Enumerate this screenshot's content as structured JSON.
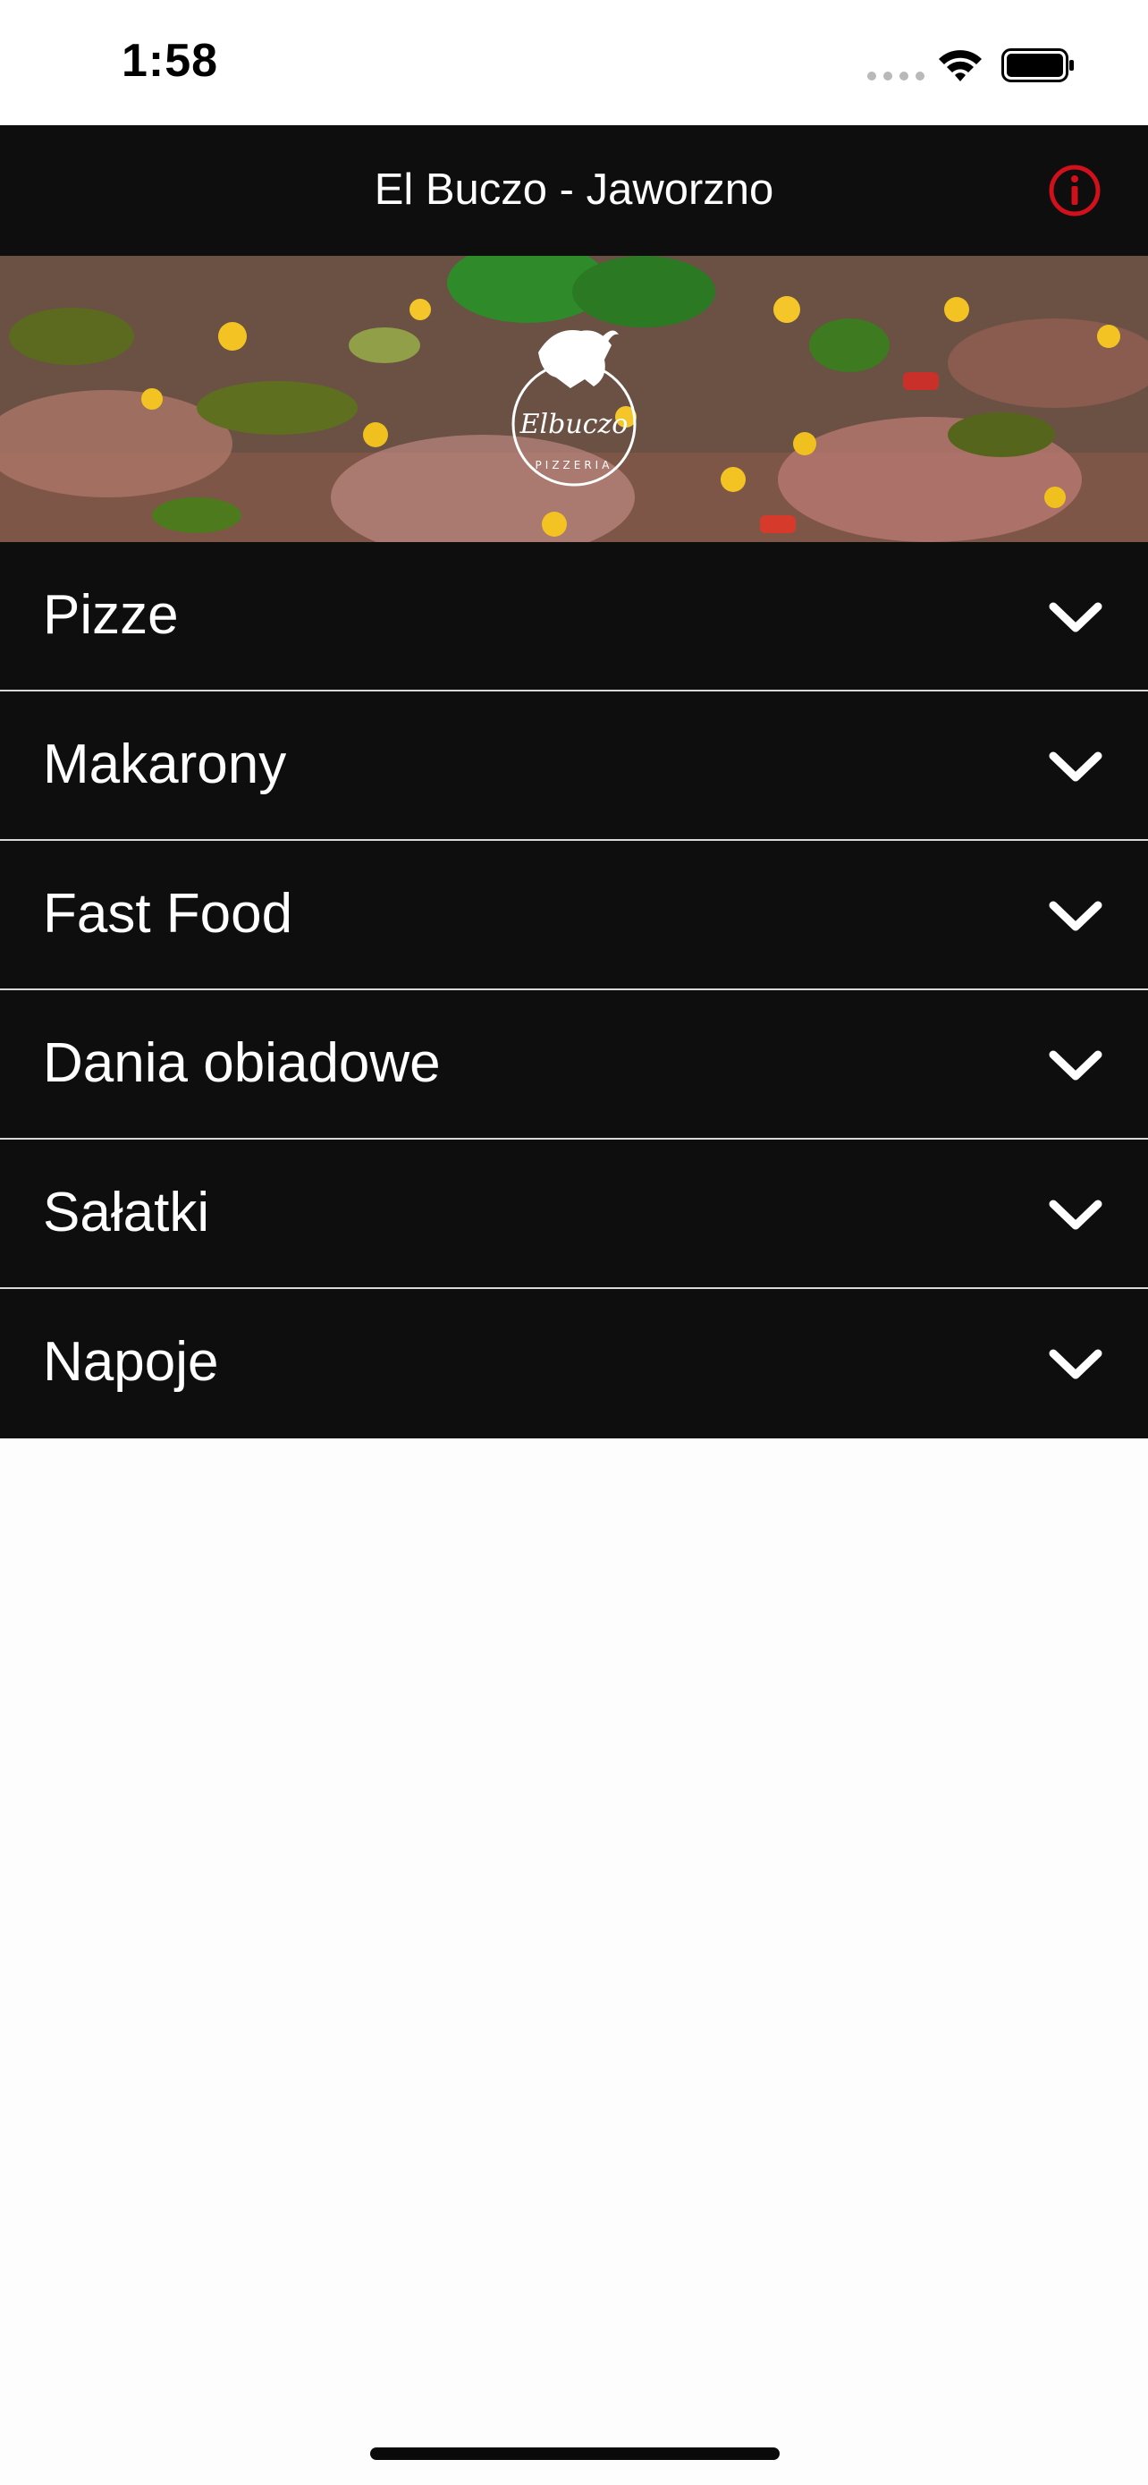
{
  "status_bar": {
    "time": "1:58"
  },
  "header": {
    "title": "El Buczo - Jaworzno",
    "info_color": "#d0101a"
  },
  "banner": {
    "logo_text": "Elbuczo",
    "logo_subtext": "PIZZERIA"
  },
  "menu": {
    "items": [
      {
        "label": "Pizze"
      },
      {
        "label": "Makarony"
      },
      {
        "label": "Fast Food"
      },
      {
        "label": "Dania obiadowe"
      },
      {
        "label": "Sałatki"
      },
      {
        "label": "Napoje"
      }
    ]
  },
  "colors": {
    "header_bg": "#0e0e0e",
    "page_bg": "#fdfdfd",
    "accent": "#d0101a"
  }
}
